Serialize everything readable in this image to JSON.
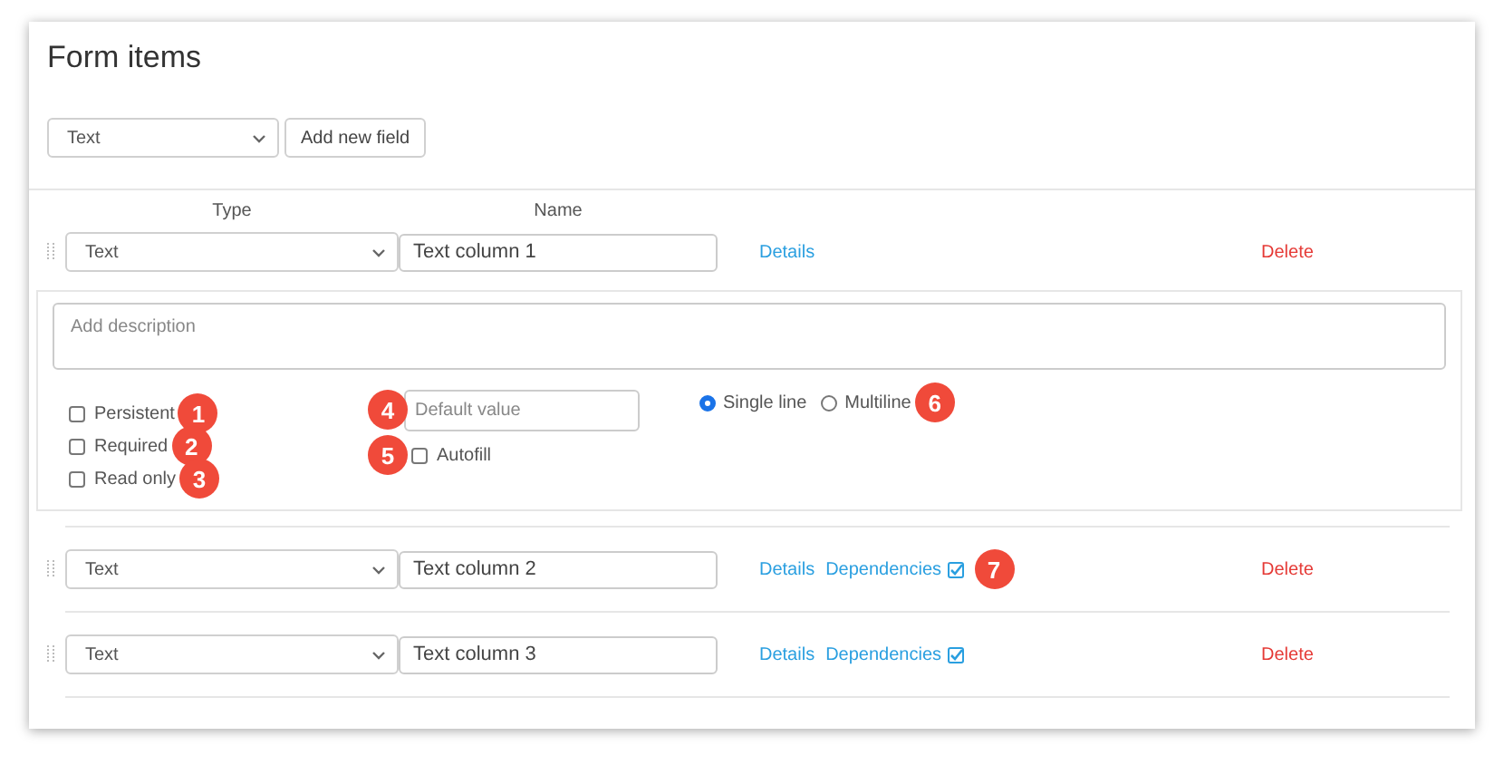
{
  "title": "Form items",
  "toolbar": {
    "type_select": "Text",
    "add_button": "Add new field"
  },
  "columns": [
    "Type",
    "Name"
  ],
  "rows": [
    {
      "type": "Text",
      "name": "Text column 1",
      "details": "Details",
      "dependencies": null,
      "delete": "Delete",
      "expanded": true
    },
    {
      "type": "Text",
      "name": "Text column 2",
      "details": "Details",
      "dependencies": {
        "label": "Dependencies",
        "badge": "7"
      },
      "delete": "Delete",
      "expanded": false
    },
    {
      "type": "Text",
      "name": "Text column 3",
      "details": "Details",
      "dependencies": {
        "label": "Dependencies"
      },
      "delete": "Delete",
      "expanded": false
    }
  ],
  "details_panel": {
    "description_placeholder": "Add description",
    "options": [
      {
        "label": "Persistent",
        "checked": false,
        "badge": "1"
      },
      {
        "label": "Required",
        "checked": false,
        "badge": "2"
      },
      {
        "label": "Read only",
        "checked": false,
        "badge": "3"
      }
    ],
    "default_value": {
      "placeholder": "Default value",
      "badge": "4"
    },
    "autofill": {
      "label": "Autofill",
      "checked": false,
      "badge": "5"
    },
    "line_modes": [
      {
        "label": "Single line",
        "selected": true
      },
      {
        "label": "Multiline",
        "selected": false,
        "badge": "6"
      }
    ]
  }
}
